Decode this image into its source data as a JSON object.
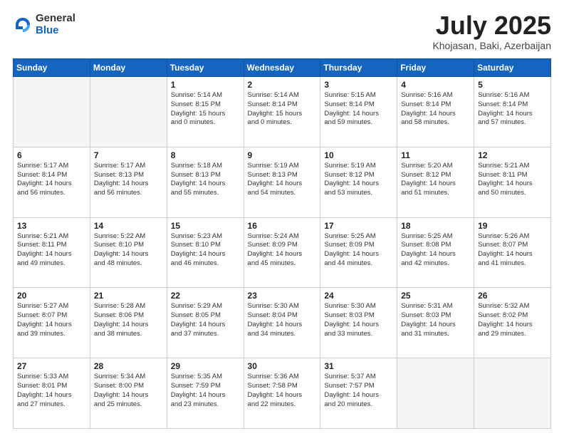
{
  "logo": {
    "general": "General",
    "blue": "Blue"
  },
  "title": {
    "month": "July 2025",
    "location": "Khojasan, Baki, Azerbaijan"
  },
  "weekdays": [
    "Sunday",
    "Monday",
    "Tuesday",
    "Wednesday",
    "Thursday",
    "Friday",
    "Saturday"
  ],
  "rows": [
    [
      {
        "day": "",
        "info": [],
        "empty": true
      },
      {
        "day": "",
        "info": [],
        "empty": true
      },
      {
        "day": "1",
        "info": [
          "Sunrise: 5:14 AM",
          "Sunset: 8:15 PM",
          "Daylight: 15 hours",
          "and 0 minutes."
        ]
      },
      {
        "day": "2",
        "info": [
          "Sunrise: 5:14 AM",
          "Sunset: 8:14 PM",
          "Daylight: 15 hours",
          "and 0 minutes."
        ]
      },
      {
        "day": "3",
        "info": [
          "Sunrise: 5:15 AM",
          "Sunset: 8:14 PM",
          "Daylight: 14 hours",
          "and 59 minutes."
        ]
      },
      {
        "day": "4",
        "info": [
          "Sunrise: 5:16 AM",
          "Sunset: 8:14 PM",
          "Daylight: 14 hours",
          "and 58 minutes."
        ]
      },
      {
        "day": "5",
        "info": [
          "Sunrise: 5:16 AM",
          "Sunset: 8:14 PM",
          "Daylight: 14 hours",
          "and 57 minutes."
        ]
      }
    ],
    [
      {
        "day": "6",
        "info": [
          "Sunrise: 5:17 AM",
          "Sunset: 8:14 PM",
          "Daylight: 14 hours",
          "and 56 minutes."
        ]
      },
      {
        "day": "7",
        "info": [
          "Sunrise: 5:17 AM",
          "Sunset: 8:13 PM",
          "Daylight: 14 hours",
          "and 56 minutes."
        ]
      },
      {
        "day": "8",
        "info": [
          "Sunrise: 5:18 AM",
          "Sunset: 8:13 PM",
          "Daylight: 14 hours",
          "and 55 minutes."
        ]
      },
      {
        "day": "9",
        "info": [
          "Sunrise: 5:19 AM",
          "Sunset: 8:13 PM",
          "Daylight: 14 hours",
          "and 54 minutes."
        ]
      },
      {
        "day": "10",
        "info": [
          "Sunrise: 5:19 AM",
          "Sunset: 8:12 PM",
          "Daylight: 14 hours",
          "and 53 minutes."
        ]
      },
      {
        "day": "11",
        "info": [
          "Sunrise: 5:20 AM",
          "Sunset: 8:12 PM",
          "Daylight: 14 hours",
          "and 51 minutes."
        ]
      },
      {
        "day": "12",
        "info": [
          "Sunrise: 5:21 AM",
          "Sunset: 8:11 PM",
          "Daylight: 14 hours",
          "and 50 minutes."
        ]
      }
    ],
    [
      {
        "day": "13",
        "info": [
          "Sunrise: 5:21 AM",
          "Sunset: 8:11 PM",
          "Daylight: 14 hours",
          "and 49 minutes."
        ]
      },
      {
        "day": "14",
        "info": [
          "Sunrise: 5:22 AM",
          "Sunset: 8:10 PM",
          "Daylight: 14 hours",
          "and 48 minutes."
        ]
      },
      {
        "day": "15",
        "info": [
          "Sunrise: 5:23 AM",
          "Sunset: 8:10 PM",
          "Daylight: 14 hours",
          "and 46 minutes."
        ]
      },
      {
        "day": "16",
        "info": [
          "Sunrise: 5:24 AM",
          "Sunset: 8:09 PM",
          "Daylight: 14 hours",
          "and 45 minutes."
        ]
      },
      {
        "day": "17",
        "info": [
          "Sunrise: 5:25 AM",
          "Sunset: 8:09 PM",
          "Daylight: 14 hours",
          "and 44 minutes."
        ]
      },
      {
        "day": "18",
        "info": [
          "Sunrise: 5:25 AM",
          "Sunset: 8:08 PM",
          "Daylight: 14 hours",
          "and 42 minutes."
        ]
      },
      {
        "day": "19",
        "info": [
          "Sunrise: 5:26 AM",
          "Sunset: 8:07 PM",
          "Daylight: 14 hours",
          "and 41 minutes."
        ]
      }
    ],
    [
      {
        "day": "20",
        "info": [
          "Sunrise: 5:27 AM",
          "Sunset: 8:07 PM",
          "Daylight: 14 hours",
          "and 39 minutes."
        ]
      },
      {
        "day": "21",
        "info": [
          "Sunrise: 5:28 AM",
          "Sunset: 8:06 PM",
          "Daylight: 14 hours",
          "and 38 minutes."
        ]
      },
      {
        "day": "22",
        "info": [
          "Sunrise: 5:29 AM",
          "Sunset: 8:05 PM",
          "Daylight: 14 hours",
          "and 37 minutes."
        ]
      },
      {
        "day": "23",
        "info": [
          "Sunrise: 5:30 AM",
          "Sunset: 8:04 PM",
          "Daylight: 14 hours",
          "and 34 minutes."
        ]
      },
      {
        "day": "24",
        "info": [
          "Sunrise: 5:30 AM",
          "Sunset: 8:03 PM",
          "Daylight: 14 hours",
          "and 33 minutes."
        ]
      },
      {
        "day": "25",
        "info": [
          "Sunrise: 5:31 AM",
          "Sunset: 8:03 PM",
          "Daylight: 14 hours",
          "and 31 minutes."
        ]
      },
      {
        "day": "26",
        "info": [
          "Sunrise: 5:32 AM",
          "Sunset: 8:02 PM",
          "Daylight: 14 hours",
          "and 29 minutes."
        ]
      }
    ],
    [
      {
        "day": "27",
        "info": [
          "Sunrise: 5:33 AM",
          "Sunset: 8:01 PM",
          "Daylight: 14 hours",
          "and 27 minutes."
        ]
      },
      {
        "day": "28",
        "info": [
          "Sunrise: 5:34 AM",
          "Sunset: 8:00 PM",
          "Daylight: 14 hours",
          "and 25 minutes."
        ]
      },
      {
        "day": "29",
        "info": [
          "Sunrise: 5:35 AM",
          "Sunset: 7:59 PM",
          "Daylight: 14 hours",
          "and 23 minutes."
        ]
      },
      {
        "day": "30",
        "info": [
          "Sunrise: 5:36 AM",
          "Sunset: 7:58 PM",
          "Daylight: 14 hours",
          "and 22 minutes."
        ]
      },
      {
        "day": "31",
        "info": [
          "Sunrise: 5:37 AM",
          "Sunset: 7:57 PM",
          "Daylight: 14 hours",
          "and 20 minutes."
        ]
      },
      {
        "day": "",
        "info": [],
        "empty": true
      },
      {
        "day": "",
        "info": [],
        "empty": true
      }
    ]
  ]
}
